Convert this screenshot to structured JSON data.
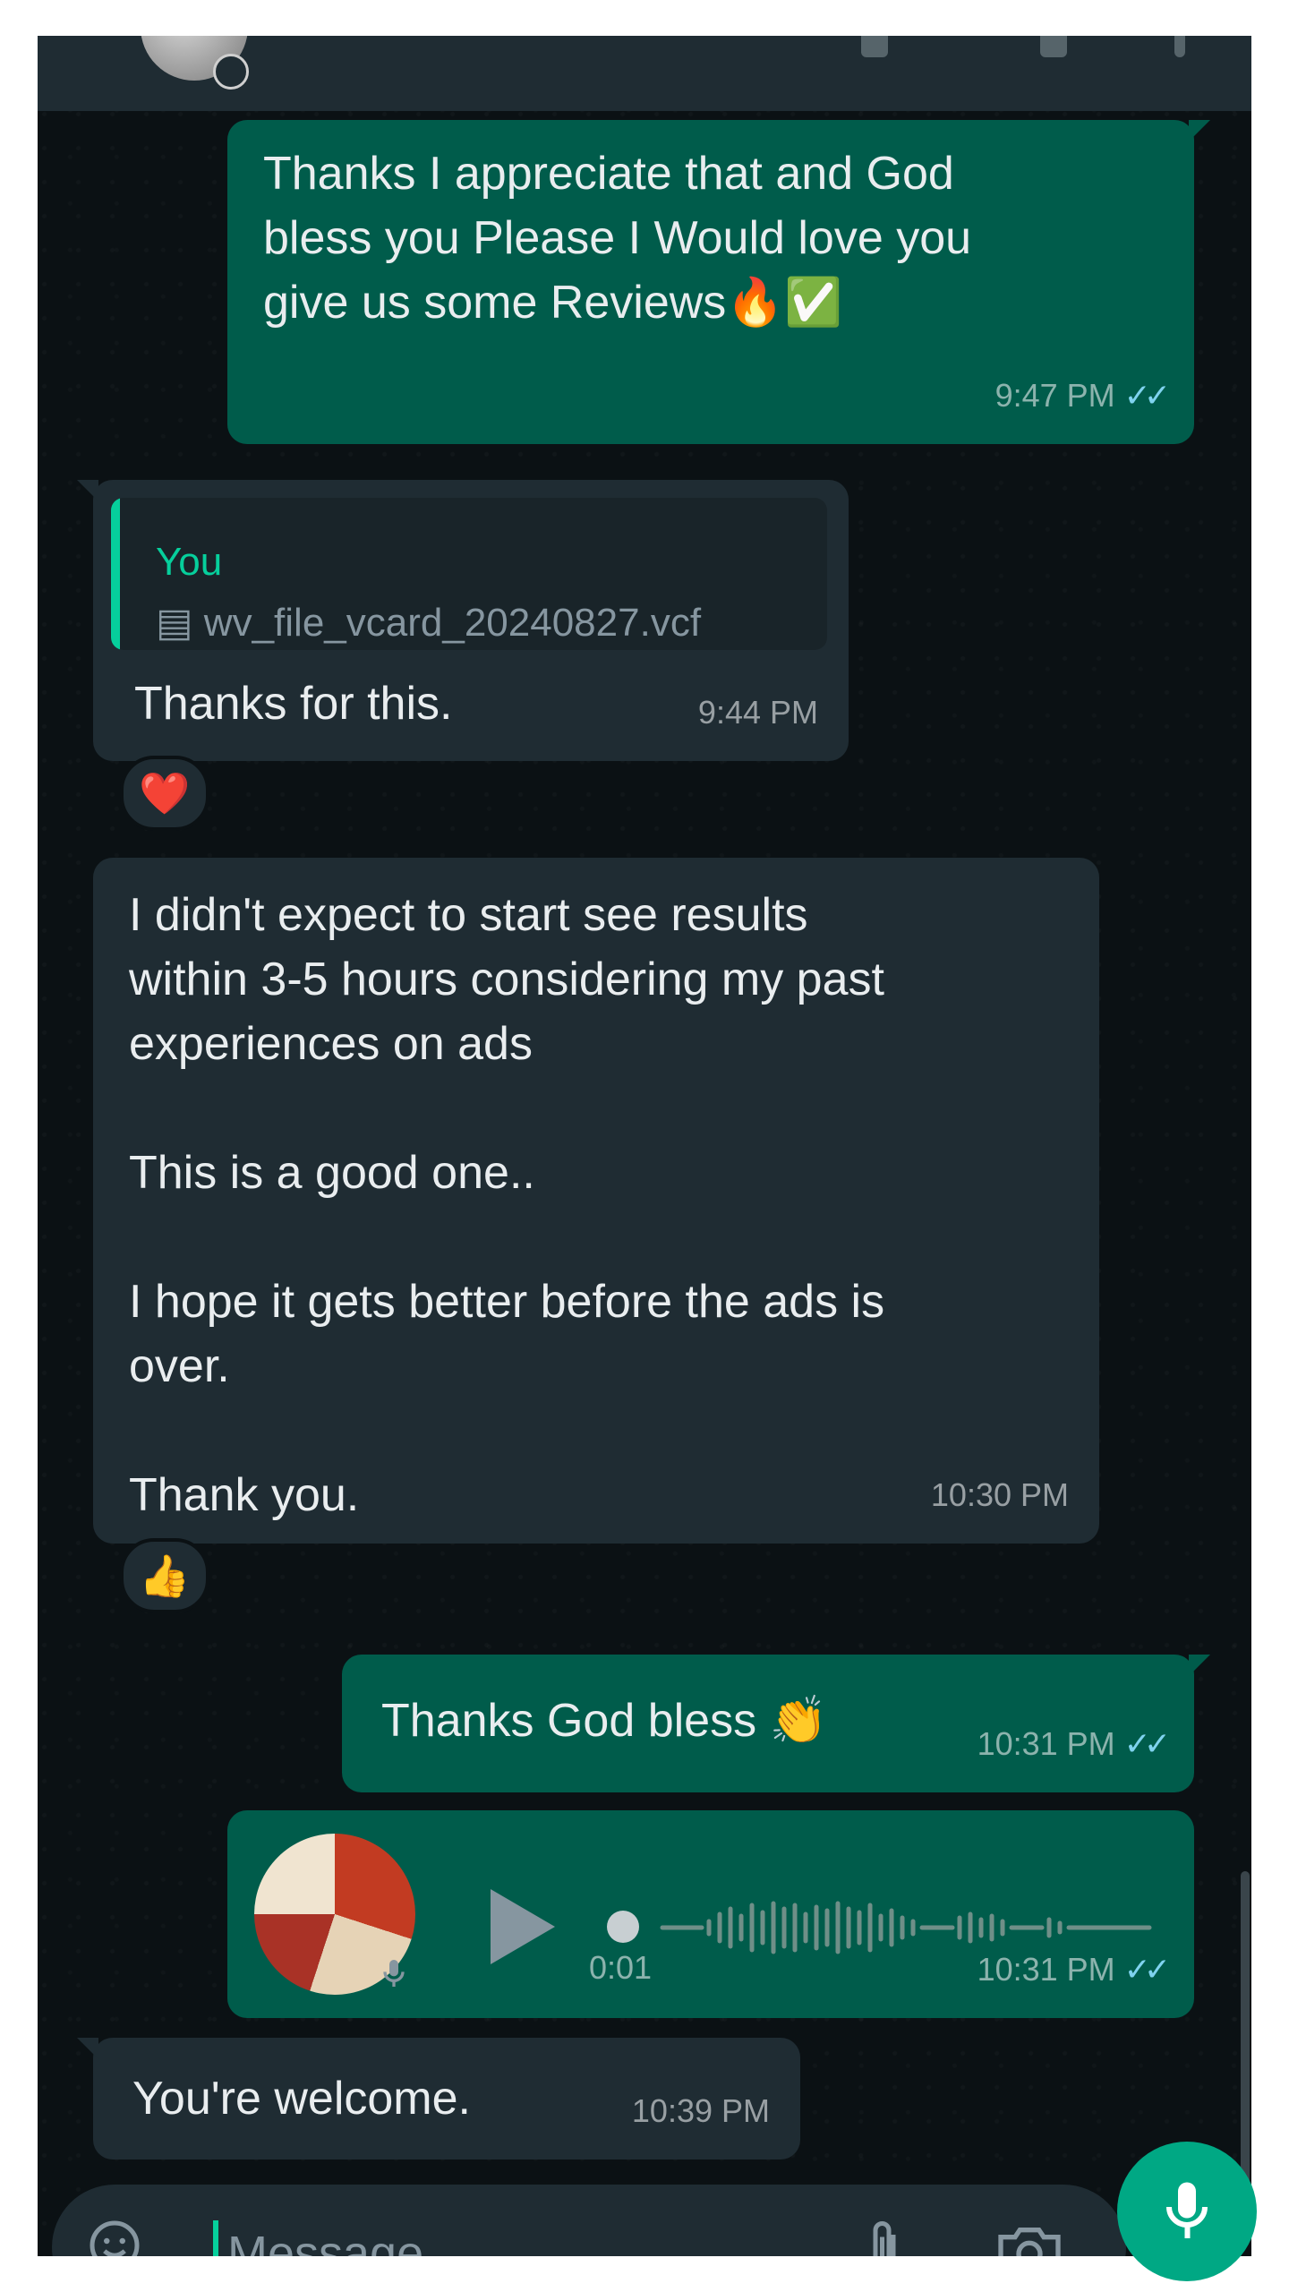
{
  "messages": {
    "m1": {
      "text": "Thanks I appreciate that and God\nbless you Please I Would love you\ngive us some Reviews🔥✅",
      "time": "9:47 PM"
    },
    "m2": {
      "quote_author": "You",
      "quote_file": "wv_file_vcard_20240827.vcf",
      "text": "Thanks for this.",
      "time": "9:44 PM",
      "reaction": "❤️"
    },
    "m3": {
      "text": "I didn't expect to start see results\nwithin 3-5 hours considering my past\nexperiences on ads\n\nThis is a good one..\n\nI hope it gets better before the ads is\nover.\n\nThank you.",
      "time": "10:30 PM",
      "reaction": "👍"
    },
    "m4": {
      "text": "Thanks God bless 👏",
      "time": "10:31 PM"
    },
    "m5": {
      "duration": "0:01",
      "time": "10:31 PM"
    },
    "m6": {
      "text": "You're welcome.",
      "time": "10:39 PM"
    }
  },
  "input": {
    "placeholder": "Message"
  },
  "ticks": "✓✓",
  "colors": {
    "background": "#0b1114",
    "outgoing_bubble": "#005c4b",
    "incoming_bubble": "#1f2c33",
    "accent": "#00a884",
    "read_ticks": "#7fd3ef"
  },
  "icons": [
    "emoji-icon",
    "attach-icon",
    "camera-icon",
    "mic-icon",
    "play-icon"
  ]
}
